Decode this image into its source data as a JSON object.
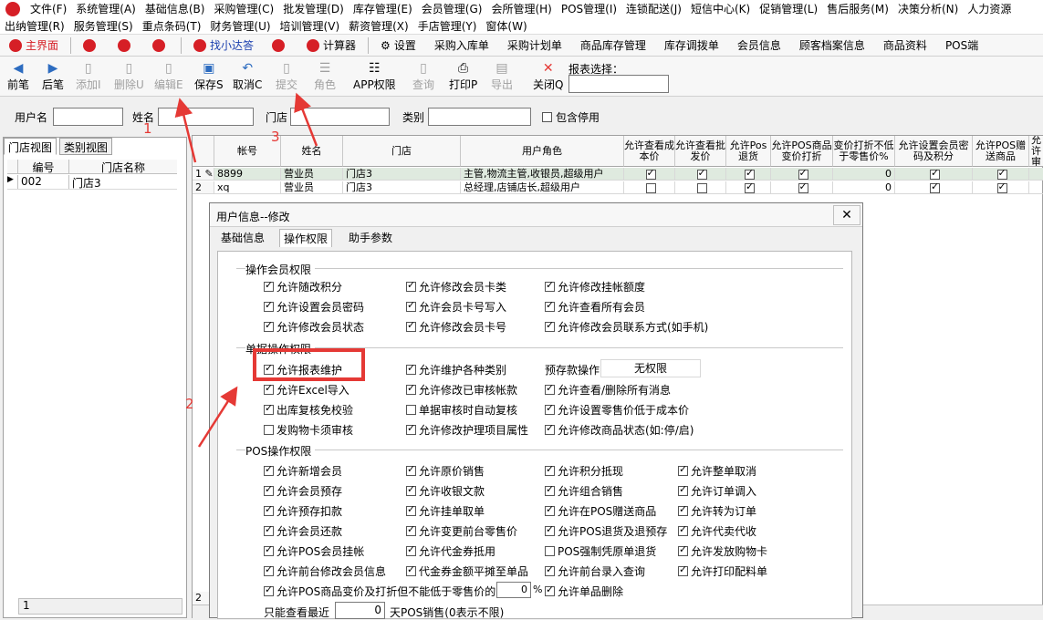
{
  "menus": {
    "row1": [
      "文件(F)",
      "系统管理(A)",
      "基础信息(B)",
      "采购管理(C)",
      "批发管理(D)",
      "库存管理(E)",
      "会员管理(G)",
      "会所管理(H)",
      "POS管理(I)",
      "连锁配送(J)",
      "短信中心(K)",
      "促销管理(L)",
      "售后服务(M)",
      "决策分析(N)",
      "人力资源"
    ],
    "row2": [
      "出纳管理(R)",
      "服务管理(S)",
      "重点条码(T)",
      "财务管理(U)",
      "培训管理(V)",
      "薪资管理(X)",
      "手店管理(Y)",
      "窗体(W)"
    ]
  },
  "quick": {
    "main": "主界面",
    "find": "找小达答",
    "calc": "计算器",
    "settings": "设置",
    "purchase_in": "采购入库单",
    "purchase_plan": "采购计划单",
    "stock_mgmt": "商品库存管理",
    "stock_transfer": "库存调拨单",
    "member_info": "会员信息",
    "customer_files": "顾客档案信息",
    "product_data": "商品资料",
    "pos": "POS端"
  },
  "toolbar": {
    "prev": "前笔",
    "next": "后笔",
    "add": "添加I",
    "delete": "删除U",
    "edit": "编辑E",
    "save": "保存S",
    "cancel": "取消C",
    "submit": "提交",
    "role": "角色",
    "app_perm": "APP权限",
    "query": "查询",
    "print": "打印P",
    "export": "导出",
    "close": "关闭Q",
    "report_label": "报表选择："
  },
  "filter": {
    "username": "用户名",
    "name": "姓名",
    "store": "门店",
    "category": "类别",
    "include_disabled": "包含停用"
  },
  "left": {
    "tab_store": "门店视图",
    "tab_category": "类别视图",
    "col_code": "编号",
    "col_name": "门店名称",
    "rows": [
      {
        "code": "002",
        "name": "门店3"
      }
    ],
    "footer": "1"
  },
  "grid": {
    "headers": [
      "帐号",
      "姓名",
      "门店",
      "用户角色",
      "允许查看成本价",
      "允许查看批发价",
      "允许Pos退货",
      "允许POS商品变价打折",
      "变价打折不低于零售价%",
      "允许设置会员密码及积分",
      "允许POS赠送商品",
      "允许审"
    ],
    "rows": [
      {
        "num": "1",
        "account": "8899",
        "name": "营业员",
        "store": "门店3",
        "roles": "主管,物流主管,收银员,超级用户",
        "c1": true,
        "c2": true,
        "c3": true,
        "c4": true,
        "pct": "0",
        "c5": true,
        "c6": true
      },
      {
        "num": "2",
        "account": "xq",
        "name": "营业员",
        "store": "门店3",
        "roles": "总经理,店铺店长,超级用户",
        "c1": false,
        "c2": false,
        "c3": true,
        "c4": true,
        "pct": "0",
        "c5": true,
        "c6": true
      }
    ],
    "footer_num": "2"
  },
  "dialog": {
    "title": "用户信息--修改",
    "tabs": [
      "基础信息",
      "操作权限",
      "助手参数"
    ],
    "member_section": "操作会员权限",
    "member": [
      [
        "允许随改积分",
        "允许修改会员卡类",
        "允许修改挂帐额度"
      ],
      [
        "允许设置会员密码",
        "允许会员卡号写入",
        "允许查看所有会员"
      ],
      [
        "允许修改会员状态",
        "允许修改会员卡号",
        "允许修改会员联系方式(如手机)"
      ]
    ],
    "doc_section": "单据操作权限",
    "doc": [
      [
        {
          "t": "允许报表维护",
          "c": true
        },
        {
          "t": "允许维护各种类别",
          "c": true
        }
      ],
      [
        {
          "t": "允许Excel导入",
          "c": true
        },
        {
          "t": "允许修改已审核帐款",
          "c": true
        },
        {
          "t": "允许查看/删除所有消息",
          "c": true
        }
      ],
      [
        {
          "t": "出库复核免校验",
          "c": true
        },
        {
          "t": "单据审核时自动复核",
          "c": false
        },
        {
          "t": "允许设置零售价低于成本价",
          "c": true
        }
      ],
      [
        {
          "t": "发购物卡须审核",
          "c": false
        },
        {
          "t": "允许修改护理项目属性",
          "c": true
        },
        {
          "t": "允许修改商品状态(如:停/启)",
          "c": true
        }
      ]
    ],
    "prepay_label": "预存款操作",
    "prepay_value": "无权限",
    "pos_section": "POS操作权限",
    "pos": [
      [
        {
          "t": "允许新增会员",
          "c": true
        },
        {
          "t": "允许原价销售",
          "c": true
        },
        {
          "t": "允许积分抵现",
          "c": true
        },
        {
          "t": "允许整单取消",
          "c": true
        }
      ],
      [
        {
          "t": "允许会员预存",
          "c": true
        },
        {
          "t": "允许收银文款",
          "c": true
        },
        {
          "t": "允许组合销售",
          "c": true
        },
        {
          "t": "允许订单调入",
          "c": true
        }
      ],
      [
        {
          "t": "允许预存扣款",
          "c": true
        },
        {
          "t": "允许挂单取单",
          "c": true
        },
        {
          "t": "允许在POS赠送商品",
          "c": true
        },
        {
          "t": "允许转为订单",
          "c": true
        }
      ],
      [
        {
          "t": "允许会员还款",
          "c": true
        },
        {
          "t": "允许变更前台零售价",
          "c": true
        },
        {
          "t": "允许POS退货及退预存",
          "c": true
        },
        {
          "t": "允许代卖代收",
          "c": true
        }
      ],
      [
        {
          "t": "允许POS会员挂帐",
          "c": true
        },
        {
          "t": "允许代金券抵用",
          "c": true
        },
        {
          "t": "POS强制凭原单退货",
          "c": false
        },
        {
          "t": "允许发放购物卡",
          "c": true
        }
      ],
      [
        {
          "t": "允许前台修改会员信息",
          "c": true
        },
        {
          "t": "代金券金额平摊至单品",
          "c": true
        },
        {
          "t": "允许前台录入查询",
          "c": true
        },
        {
          "t": "允许打印配料单",
          "c": true
        }
      ]
    ],
    "price_rule": "允许POS商品变价及打折但不能低于零售价的",
    "price_rule_value": "0",
    "price_unit": "%",
    "single_delete": "允许单品删除",
    "recent_prefix": "只能查看最近",
    "recent_value": "0",
    "recent_suffix": "天POS销售(0表示不限)"
  },
  "annotations": [
    "1",
    "2",
    "3"
  ],
  "colors": {
    "accent": "#d61f26",
    "annotation": "#e53935",
    "row_selected": "#dfeadf"
  }
}
